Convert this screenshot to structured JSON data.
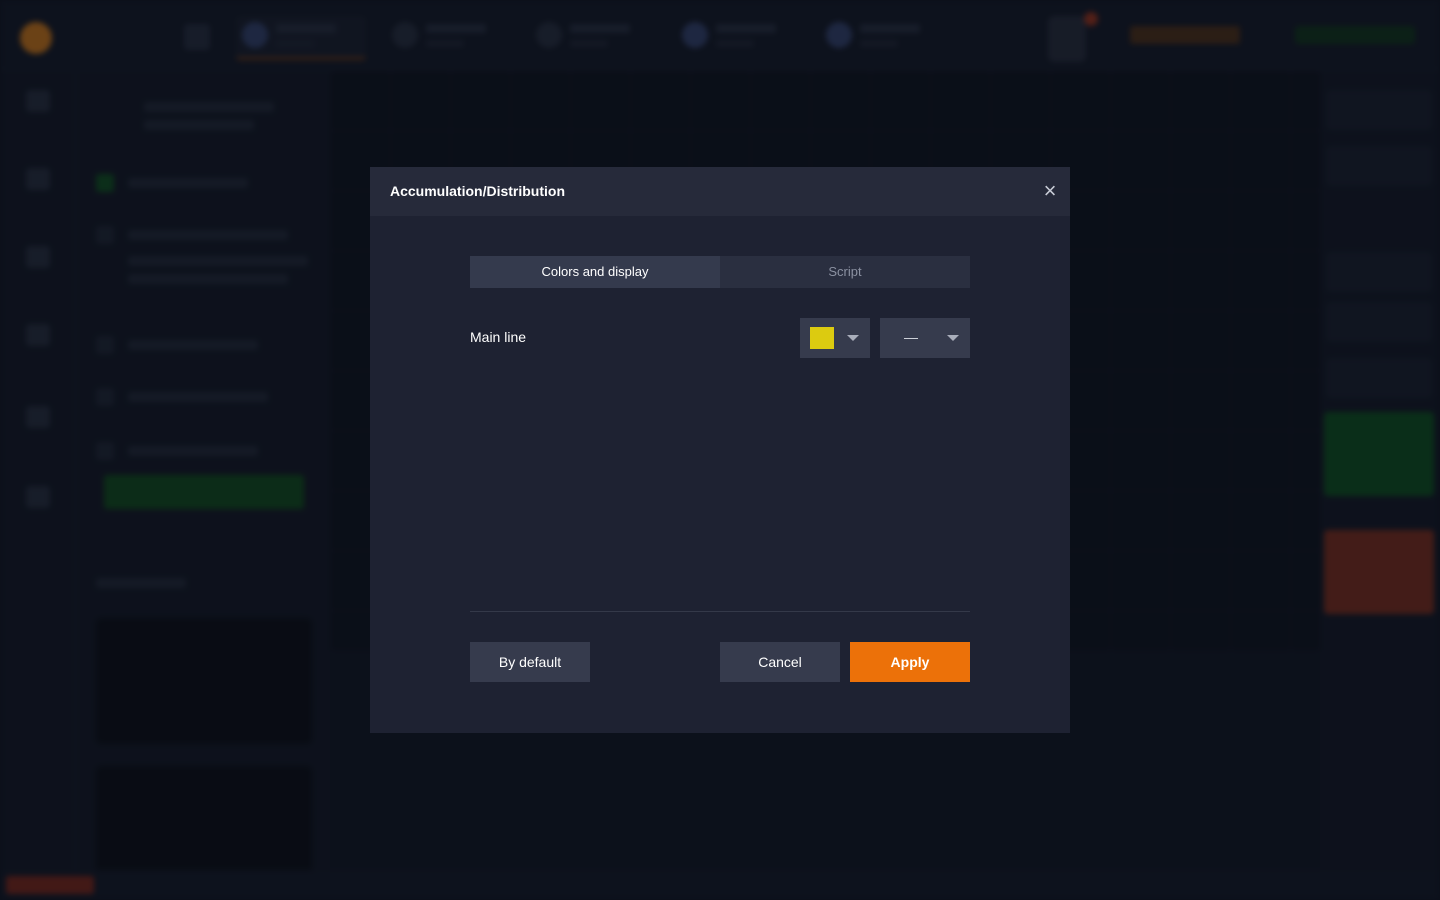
{
  "modal": {
    "title": "Accumulation/Distribution",
    "close_symbol": "×",
    "tabs": [
      {
        "label": "Colors and display",
        "active": true
      },
      {
        "label": "Script",
        "active": false
      }
    ],
    "main_line": {
      "label": "Main line",
      "color": "#dccb10",
      "line_style": "—"
    },
    "buttons": {
      "default_label": "By default",
      "cancel_label": "Cancel",
      "apply_label": "Apply"
    }
  },
  "theme": {
    "accent": "#ec7109",
    "modal_bg": "#1e2232",
    "header_bg": "#262a3a",
    "control_bg": "#363b4d"
  }
}
